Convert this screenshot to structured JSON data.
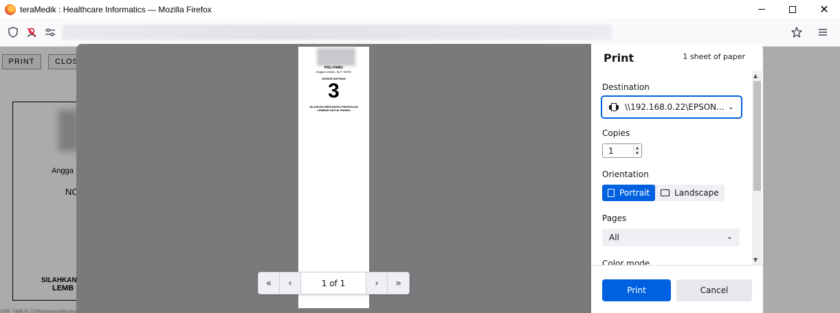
{
  "window": {
    "title": "teraMedik : Healthcare Informatics — Mozilla Firefox"
  },
  "page": {
    "print_btn": "PRINT",
    "close_btn": "CLOS",
    "ticket_line1": "Angga",
    "ticket_line2": "NC",
    "ticket_line3": "SILAHKAN",
    "ticket_line4": "LEMB"
  },
  "preview": {
    "poli": "POLI PARU",
    "doctor": "Anggara Aditya, Sp.P, MARS",
    "nomor_label": "NOMOR ANTRIAN",
    "number": "3",
    "note1": "SILAHKAN MENUNGGU PANGGILAN",
    "note2": "LEMBAR UNTUK PASIEN"
  },
  "pager": {
    "label": "1 of 1"
  },
  "print_panel": {
    "title": "Print",
    "sheet_count": "1 sheet of paper",
    "destination_label": "Destination",
    "destination_value": "\\\\192.168.0.22\\EPSON...",
    "copies_label": "Copies",
    "copies_value": "1",
    "orientation_label": "Orientation",
    "portrait": "Portrait",
    "landscape": "Landscape",
    "pages_label": "Pages",
    "pages_value": "All",
    "color_label": "Color mode",
    "print_button": "Print",
    "cancel_button": "Cancel"
  },
  "colors": {
    "accent": "#0061e0"
  }
}
